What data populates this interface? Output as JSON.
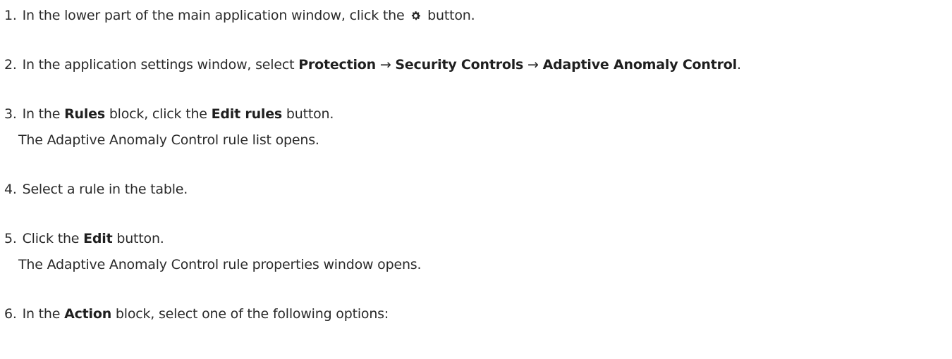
{
  "steps": [
    {
      "number": "1.",
      "text_a": "In the lower part of the main application window, click the",
      "icon": "gear-icon",
      "text_b": "button."
    },
    {
      "number": "2.",
      "text_a": "In the application settings window, select",
      "path": [
        "Protection",
        "Security Controls",
        "Adaptive Anomaly Control"
      ],
      "arrow": "→",
      "end": "."
    },
    {
      "number": "3.",
      "text_a": "In the",
      "bold_1": "Rules",
      "text_b": "block, click the",
      "bold_2": "Edit rules",
      "text_c": "button.",
      "result": "The Adaptive Anomaly Control rule list opens."
    },
    {
      "number": "4.",
      "text_a": "Select a rule in the table."
    },
    {
      "number": "5.",
      "text_a": "Click the",
      "bold_1": "Edit",
      "text_b": "button.",
      "result": "The Adaptive Anomaly Control rule properties window opens."
    },
    {
      "number": "6.",
      "text_a": "In the",
      "bold_1": "Action",
      "text_b": "block, select one of the following options:"
    }
  ],
  "colors": {
    "text": "#2a2a2a",
    "icon": "#2a2a2a"
  }
}
